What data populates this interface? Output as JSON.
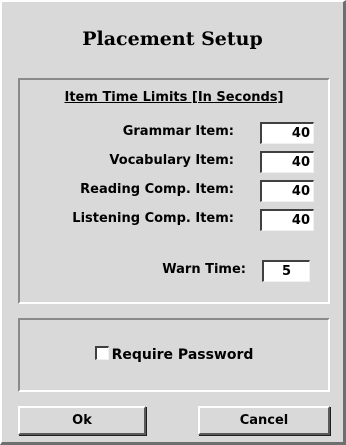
{
  "dialog": {
    "title": "Placement Setup"
  },
  "item_time_limits": {
    "heading": "Item Time Limits [In Seconds]",
    "rows": [
      {
        "label": "Grammar Item:",
        "value": "40"
      },
      {
        "label": "Vocabulary Item:",
        "value": "40"
      },
      {
        "label": "Reading Comp. Item:",
        "value": "40"
      },
      {
        "label": "Listening Comp. Item:",
        "value": "40"
      }
    ],
    "warn_time": {
      "label": "Warn Time:",
      "value": "5"
    }
  },
  "password": {
    "label": "Require Password",
    "checked": false
  },
  "buttons": {
    "ok_label": "Ok",
    "cancel_label": "Cancel"
  },
  "colors": {
    "face": "#d9d9d9",
    "highlight": "#ffffff",
    "shadow": "#6f6f6f",
    "field_bg": "#ffffff"
  }
}
